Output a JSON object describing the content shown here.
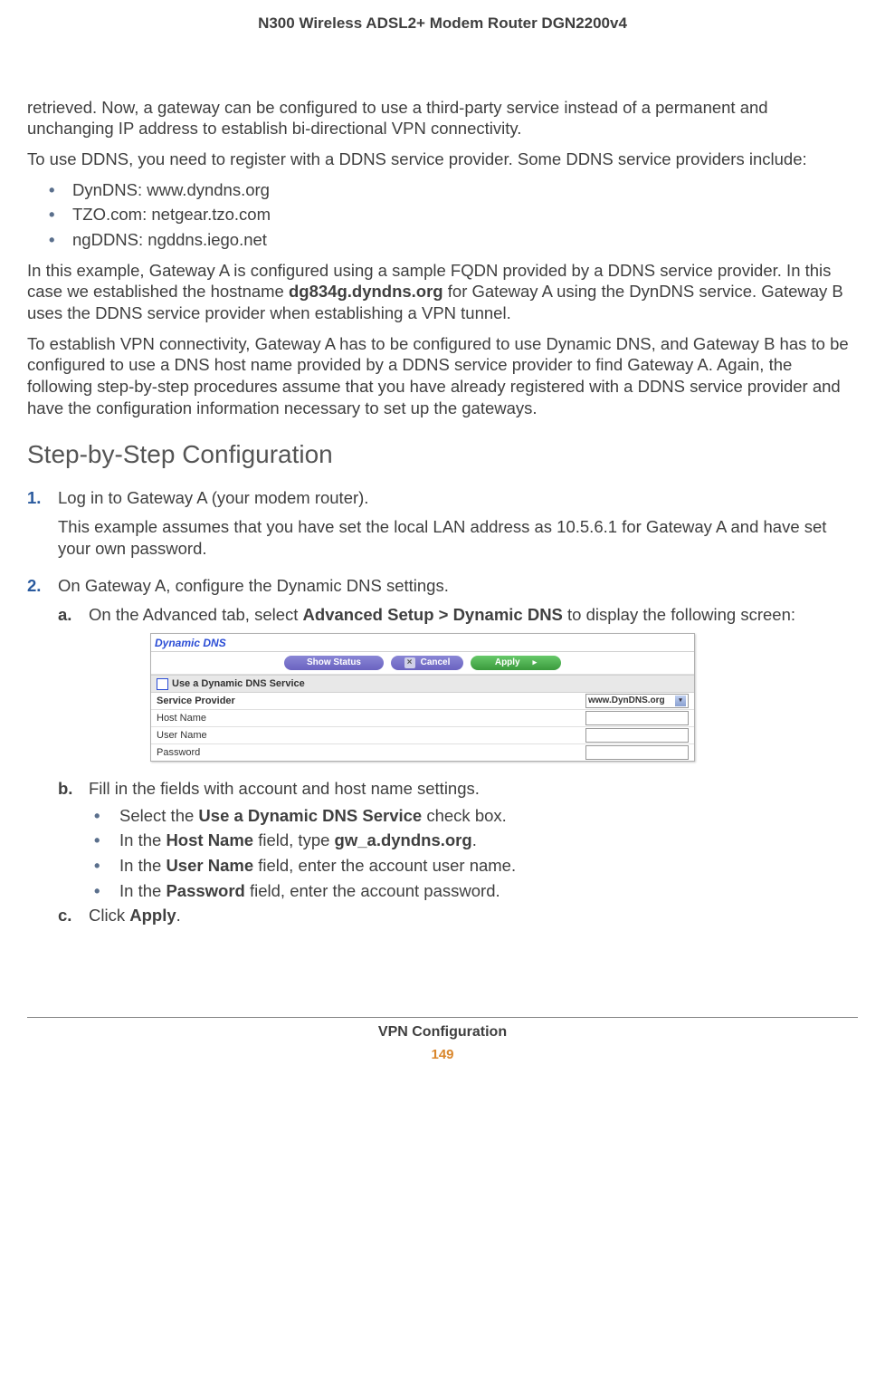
{
  "header": {
    "product_title": "N300 Wireless ADSL2+ Modem Router DGN2200v4"
  },
  "body": {
    "para1": "retrieved. Now, a gateway can be configured to use a third-party service instead of a permanent and unchanging IP address to establish bi-directional VPN connectivity.",
    "para2": "To use DDNS, you need to register with a DDNS service provider. Some DDNS service providers include:",
    "providers": [
      "DynDNS: www.dyndns.org",
      "TZO.com: netgear.tzo.com",
      "ngDDNS: ngddns.iego.net"
    ],
    "para3a": "In this example, Gateway A is configured using a sample FQDN provided by a DDNS service provider. In this case we established the hostname ",
    "para3_bold": "dg834g.dyndns.org",
    "para3b": " for Gateway A using the DynDNS service. Gateway B uses the DDNS service provider when establishing a VPN tunnel.",
    "para4": "To establish VPN connectivity, Gateway A has to be configured to use Dynamic DNS, and Gateway B has to be configured to use a DNS host name provided by a DDNS service provider to find Gateway A. Again, the following step-by-step procedures assume that you have already registered with a DDNS service provider and have the configuration information necessary to set up the gateways.",
    "heading": "Step-by-Step Configuration",
    "step1_main": "Log in to Gateway A (your modem router).",
    "step1_sub": "This example assumes that you have set the local LAN address as 10.5.6.1 for Gateway A and have set your own password.",
    "step2_main": "On Gateway A, configure the Dynamic DNS settings.",
    "step2a_pre": "On the Advanced tab, select ",
    "step2a_bold": "Advanced Setup > Dynamic DNS",
    "step2a_post": " to display the following screen:",
    "screenshot": {
      "title": "Dynamic DNS",
      "btn_show": "Show Status",
      "btn_cancel": "Cancel",
      "btn_apply": "Apply",
      "checkbox_label": "Use a Dynamic DNS Service",
      "row_provider": "Service Provider",
      "row_host": "Host Name",
      "row_user": "User Name",
      "row_pass": "Password",
      "select_value": "www.DynDNS.org"
    },
    "step2b": "Fill in the fields with account and host name settings.",
    "b_items": {
      "i1_pre": "Select the ",
      "i1_bold": "Use a Dynamic DNS Service",
      "i1_post": " check box.",
      "i2_pre": "In the ",
      "i2_b1": "Host Name",
      "i2_mid": " field, type ",
      "i2_b2": "gw_a.dyndns.org",
      "i2_post": ".",
      "i3_pre": "In the ",
      "i3_bold": "User Name",
      "i3_post": " field, enter the account user name.",
      "i4_pre": "In the ",
      "i4_bold": "Password",
      "i4_post": " field, enter the account password."
    },
    "step2c_pre": "Click ",
    "step2c_bold": "Apply",
    "step2c_post": "."
  },
  "footer": {
    "section": "VPN Configuration",
    "page": "149"
  }
}
